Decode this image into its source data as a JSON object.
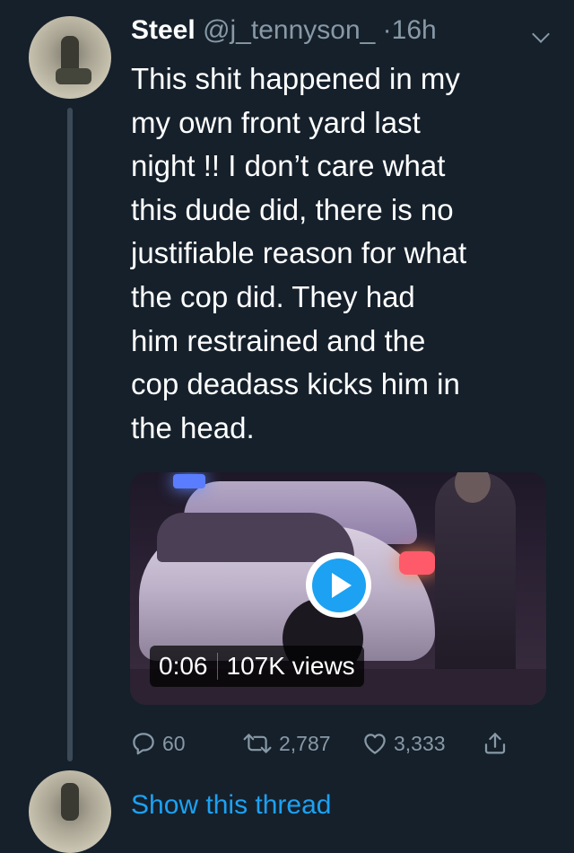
{
  "tweet": {
    "display_name": "Steel",
    "handle": "@j_tennyson_",
    "separator": "·",
    "time": "16h",
    "text_lines": [
      "This shit happened in my",
      "my own front yard last",
      "night !! I don’t care what",
      "this dude did, there is no",
      "justifiable reason for what",
      "the cop did. They had",
      "him restrained and the",
      "cop deadass kicks him in",
      "the head."
    ]
  },
  "media": {
    "type": "video",
    "duration": "0:06",
    "views": "107K views"
  },
  "actions": {
    "replies": "60",
    "retweets": "2,787",
    "likes": "3,333"
  },
  "next": {
    "show_thread_label": "Show this thread"
  },
  "colors": {
    "background": "#15202b",
    "secondary_text": "#8899a6",
    "accent": "#1da1f2",
    "thread_line": "#3c4a57"
  },
  "icons": [
    "reply-icon",
    "retweet-icon",
    "like-icon",
    "share-icon",
    "chevron-down-icon",
    "play-icon"
  ]
}
